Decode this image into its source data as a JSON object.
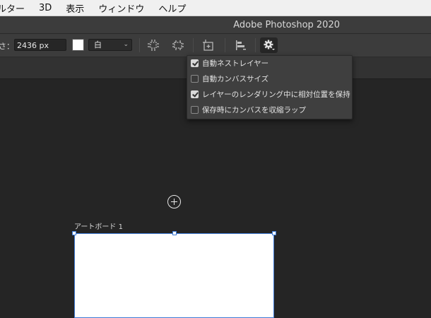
{
  "menubar": {
    "items": [
      "ルター",
      "3D",
      "表示",
      "ウィンドウ",
      "ヘルプ"
    ]
  },
  "window": {
    "title": "Adobe Photoshop 2020"
  },
  "options_bar": {
    "size_label": "さ：",
    "size_value": "2436 px",
    "fill_color": "#ffffff",
    "background_select": "白",
    "tools": [
      "artboard-fit-icon",
      "artboard-to-selection-icon",
      "add-artboard-icon",
      "align-icon",
      "gear-icon"
    ]
  },
  "settings_menu": {
    "items": [
      {
        "label": "自動ネストレイヤー",
        "checked": true
      },
      {
        "label": "自動カンバスサイズ",
        "checked": false
      },
      {
        "label": "レイヤーのレンダリング中に相対位置を保持",
        "checked": true
      },
      {
        "label": "保存時にカンバスを収縮ラップ",
        "checked": false
      }
    ]
  },
  "canvas": {
    "artboard_label": "アートボード 1",
    "artboard_color": "#ffffff",
    "selection_color": "#3e7bd6"
  }
}
